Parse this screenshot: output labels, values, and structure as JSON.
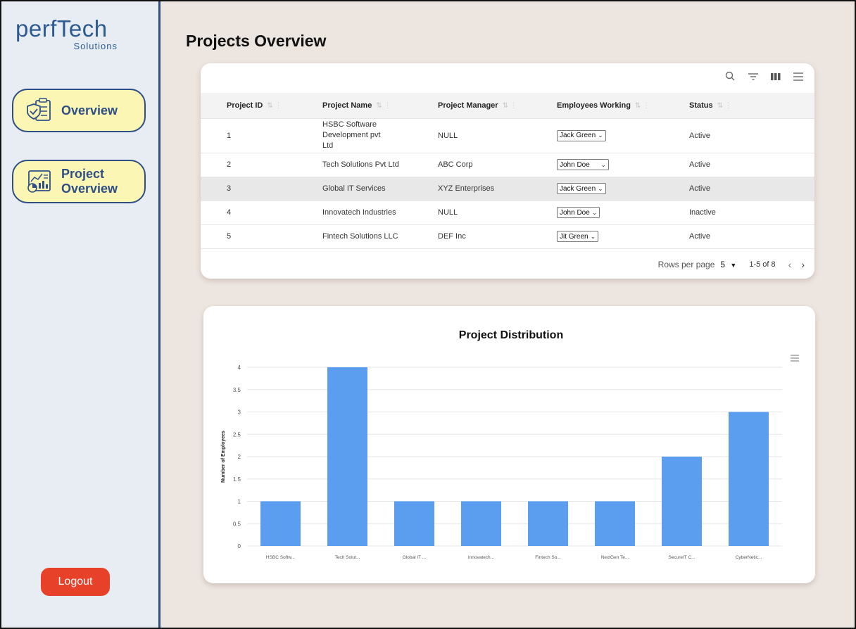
{
  "brand": {
    "name": "perfTech",
    "tagline": "Solutions"
  },
  "sidebar": {
    "items": [
      {
        "label": "Overview",
        "icon": "shield-checklist-icon"
      },
      {
        "label": "Project\nOverview",
        "label_line1": "Project",
        "label_line2": "Overview",
        "icon": "analytics-board-icon"
      }
    ],
    "logout_label": "Logout"
  },
  "page": {
    "title": "Projects Overview"
  },
  "table": {
    "columns": [
      "Project ID",
      "Project Name",
      "Project Manager",
      "Employees Working",
      "Status"
    ],
    "rows": [
      {
        "id": "1",
        "name": "HSBC Software Development pvt Ltd",
        "manager": "NULL",
        "employee": "Jack Green",
        "status": "Active"
      },
      {
        "id": "2",
        "name": "Tech Solutions Pvt Ltd",
        "manager": "ABC Corp",
        "employee": "John Doe",
        "status": "Active"
      },
      {
        "id": "3",
        "name": "Global IT Services",
        "manager": "XYZ Enterprises",
        "employee": "Jack Green",
        "status": "Active"
      },
      {
        "id": "4",
        "name": "Innovatech Industries",
        "manager": "NULL",
        "employee": "John Doe",
        "status": "Inactive"
      },
      {
        "id": "5",
        "name": "Fintech Solutions LLC",
        "manager": "DEF Inc",
        "employee": "Jit Green",
        "status": "Active"
      }
    ],
    "pagination": {
      "rows_per_page_label": "Rows per page",
      "rows_per_page": "5",
      "range": "1-5 of 8"
    }
  },
  "chart_data": {
    "type": "bar",
    "title": "Project Distribution",
    "ylabel": "Number of Employees",
    "xlabel": "",
    "categories": [
      "HSBC Softw...",
      "Tech Solut...",
      "Global IT ...",
      "Innovatech...",
      "Fintech So...",
      "NextGen Te...",
      "SecureIT C...",
      "CyberNetic..."
    ],
    "values": [
      1,
      4,
      1,
      1,
      1,
      1,
      2,
      3
    ],
    "ylim": [
      0,
      4
    ],
    "yticks": [
      "0",
      "0.5",
      "1",
      "1.5",
      "2",
      "2.5",
      "3",
      "3.5",
      "4"
    ],
    "bar_color": "#5b9ef0",
    "grid": true
  },
  "colors": {
    "accent": "#2d4f86",
    "nav_bg": "#fbf6b4",
    "logout": "#e84129"
  }
}
